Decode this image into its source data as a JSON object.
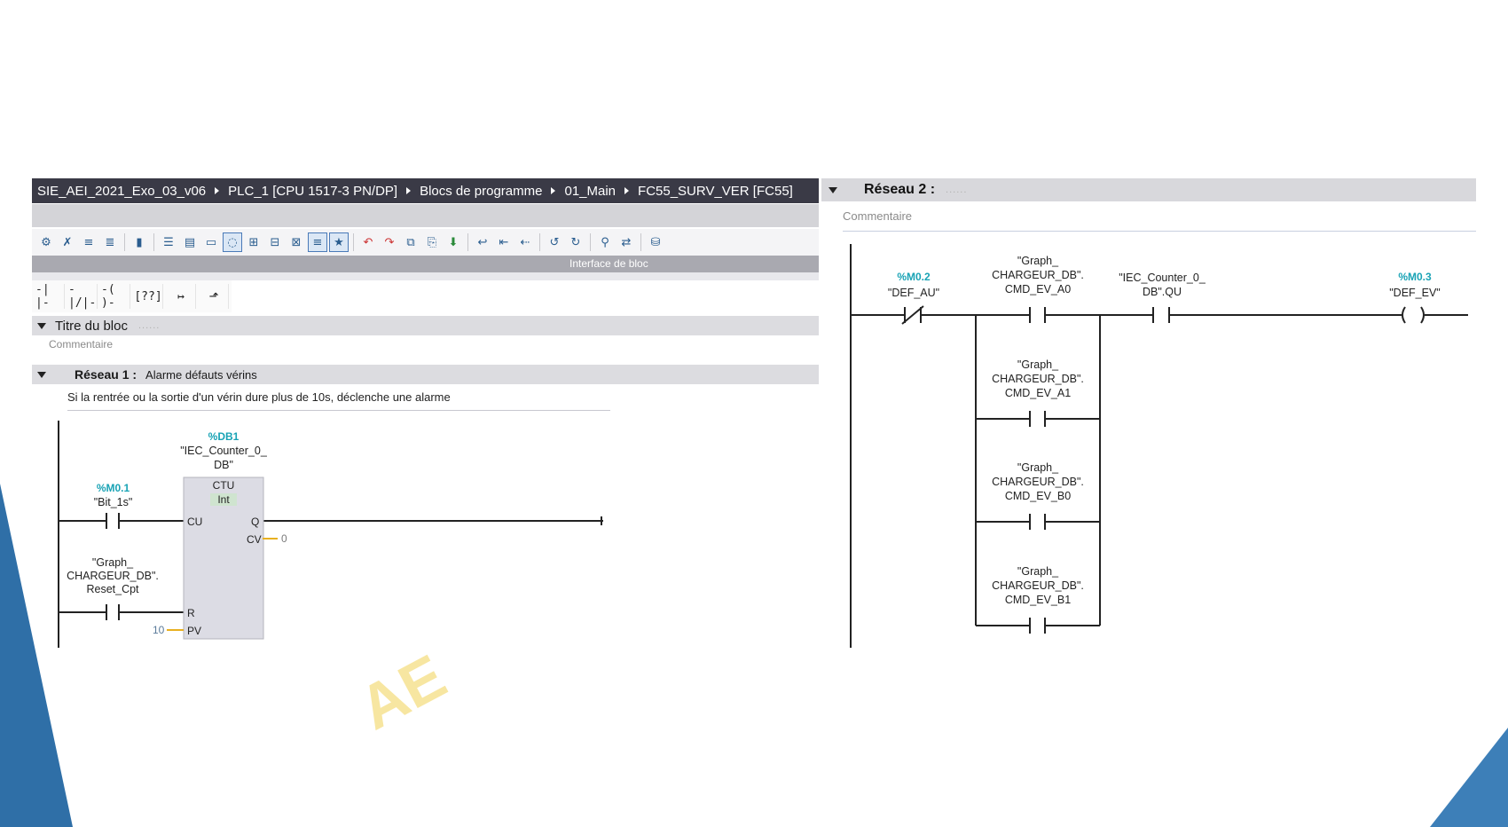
{
  "breadcrumb": {
    "items": [
      "SIE_AEI_2021_Exo_03_v06",
      "PLC_1 [CPU 1517-3 PN/DP]",
      "Blocs de programme",
      "01_Main",
      "FC55_SURV_VER [FC55]"
    ]
  },
  "toolbar": {
    "icons": [
      "compile-icon",
      "compile-clear-icon",
      "insert-icon",
      "insert-all-icon",
      "monitor-icon",
      "network-view-icon",
      "list-view-icon",
      "favorite-view-icon",
      "comment-toggle-icon",
      "network-expand-icon",
      "absolute-address-icon",
      "symbolic-address-icon",
      "show-info-icon",
      "favorites-icon",
      "delete-icon",
      "delete-all-icon",
      "copy-icon",
      "paste-icon",
      "download-icon",
      "goto-icon",
      "first-icon",
      "prev-icon",
      "next-icon",
      "last-icon",
      "search-icon",
      "replace-icon",
      "db-icon"
    ]
  },
  "interface_bar": {
    "label": "Interface de bloc"
  },
  "lad_toolbar": {
    "buttons": [
      "-| |-",
      "-|/|-",
      "-( )-",
      "[??]",
      "↦",
      "⬏"
    ]
  },
  "block_title": {
    "label": "Titre du bloc",
    "dots": "......",
    "comment": "Commentaire"
  },
  "network1": {
    "label": "Réseau 1 :",
    "title": "Alarme défauts vérins",
    "comment": "Si la rentrée ou la sortie d'un vérin dure plus de 10s, déclenche une alarme",
    "counter": {
      "db_addr": "%DB1",
      "db_name": "\"IEC_Counter_0_\nDB\"",
      "type": "CTU",
      "datatype": "Int",
      "pin_cu": "CU",
      "pin_r": "R",
      "pin_pv": "PV",
      "pin_q": "Q",
      "pin_cv": "CV",
      "cv_value": "0",
      "pv_value": "10"
    },
    "contact1": {
      "addr": "%M0.1",
      "name": "\"Bit_1s\""
    },
    "contact2": {
      "name": "\"Graph_\nCHARGEUR_DB\".\nReset_Cpt"
    }
  },
  "network2": {
    "label": "Réseau 2 :",
    "dots": "......",
    "comment": "Commentaire",
    "nc_contact": {
      "addr": "%M0.2",
      "name": "\"DEF_AU\""
    },
    "branch_contacts": [
      "\"Graph_\nCHARGEUR_DB\".\nCMD_EV_A0",
      "\"Graph_\nCHARGEUR_DB\".\nCMD_EV_A1",
      "\"Graph_\nCHARGEUR_DB\".\nCMD_EV_B0",
      "\"Graph_\nCHARGEUR_DB\".\nCMD_EV_B1"
    ],
    "qu_contact": {
      "name": "\"IEC_Counter_0_\nDB\".QU"
    },
    "coil": {
      "addr": "%M0.3",
      "name": "\"DEF_EV\""
    }
  },
  "colors": {
    "breadcrumb_bg": "#3a3a46",
    "address": "#19a3b5",
    "slide_accent": "#2f6fa7"
  }
}
